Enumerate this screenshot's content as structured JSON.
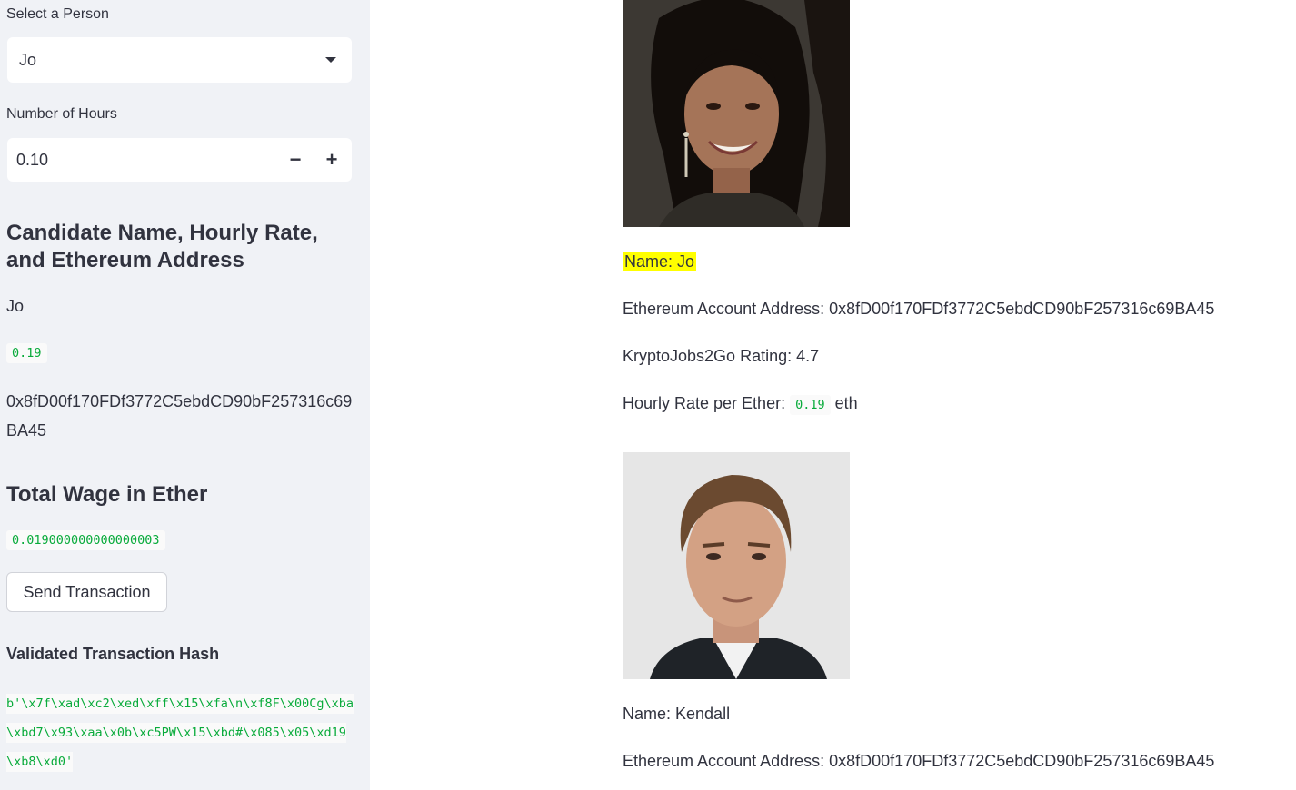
{
  "sidebar": {
    "select_label": "Select a Person",
    "select_value": "Jo",
    "hours_label": "Number of Hours",
    "hours_value": "0.10",
    "minus_label": "−",
    "plus_label": "+",
    "candidate_heading": "Candidate Name, Hourly Rate, and Ethereum Address",
    "candidate_name": "Jo",
    "candidate_rate": "0.19",
    "candidate_address": "0x8fD00f170FDf3772C5ebdCD90bF257316c69BA45",
    "wage_heading": "Total Wage in Ether",
    "wage_value": "0.019000000000000003",
    "send_button": "Send Transaction",
    "hash_heading": "Validated Transaction Hash",
    "hash_value": "b'\\x7f\\xad\\xc2\\xed\\xff\\x15\\xfa\\n\\xf8F\\x00Cg\\xba\\xbd7\\x93\\xaa\\x0b\\xc5PW\\x15\\xbd#\\x085\\x05\\xd19\\xb8\\xd0'"
  },
  "candidates": [
    {
      "name": "Name: Jo",
      "address": "Ethereum Account Address: 0x8fD00f170FDf3772C5ebdCD90bF257316c69BA45",
      "rating": "KryptoJobs2Go Rating: 4.7",
      "rate_prefix": "Hourly Rate per Ether:",
      "rate_value": "0.19",
      "rate_suffix": "eth"
    },
    {
      "name": "Name: Kendall",
      "address": "Ethereum Account Address: 0x8fD00f170FDf3772C5ebdCD90bF257316c69BA45"
    }
  ],
  "colors": {
    "sidebar_bg": "#f0f2f6",
    "text": "#31333f",
    "code_green": "#09ab3b",
    "highlight": "#ffff00"
  }
}
